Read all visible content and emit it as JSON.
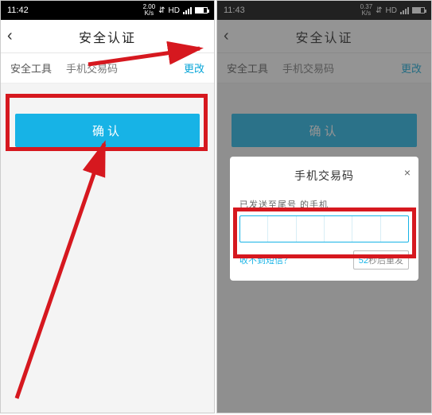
{
  "left": {
    "status": {
      "time": "11:42",
      "net": "2.00\nK/s",
      "hd": "HD"
    },
    "header": {
      "back": "‹",
      "title": "安全认证"
    },
    "row": {
      "left": "安全工具",
      "mid": "手机交易码",
      "link": "更改"
    },
    "button": "确认"
  },
  "right": {
    "status": {
      "time": "11:43",
      "net": "0.37\nK/s",
      "hd": "HD"
    },
    "header": {
      "back": "‹",
      "title": "安全认证"
    },
    "row": {
      "left": "安全工具",
      "mid": "手机交易码",
      "link": "更改"
    },
    "button": "确认",
    "dialog": {
      "title": "手机交易码",
      "close": "×",
      "sub": "已发送至尾号   的手机",
      "help": "收不到短信？",
      "resend_sec": "52",
      "resend_suffix": "秒后重发"
    }
  }
}
